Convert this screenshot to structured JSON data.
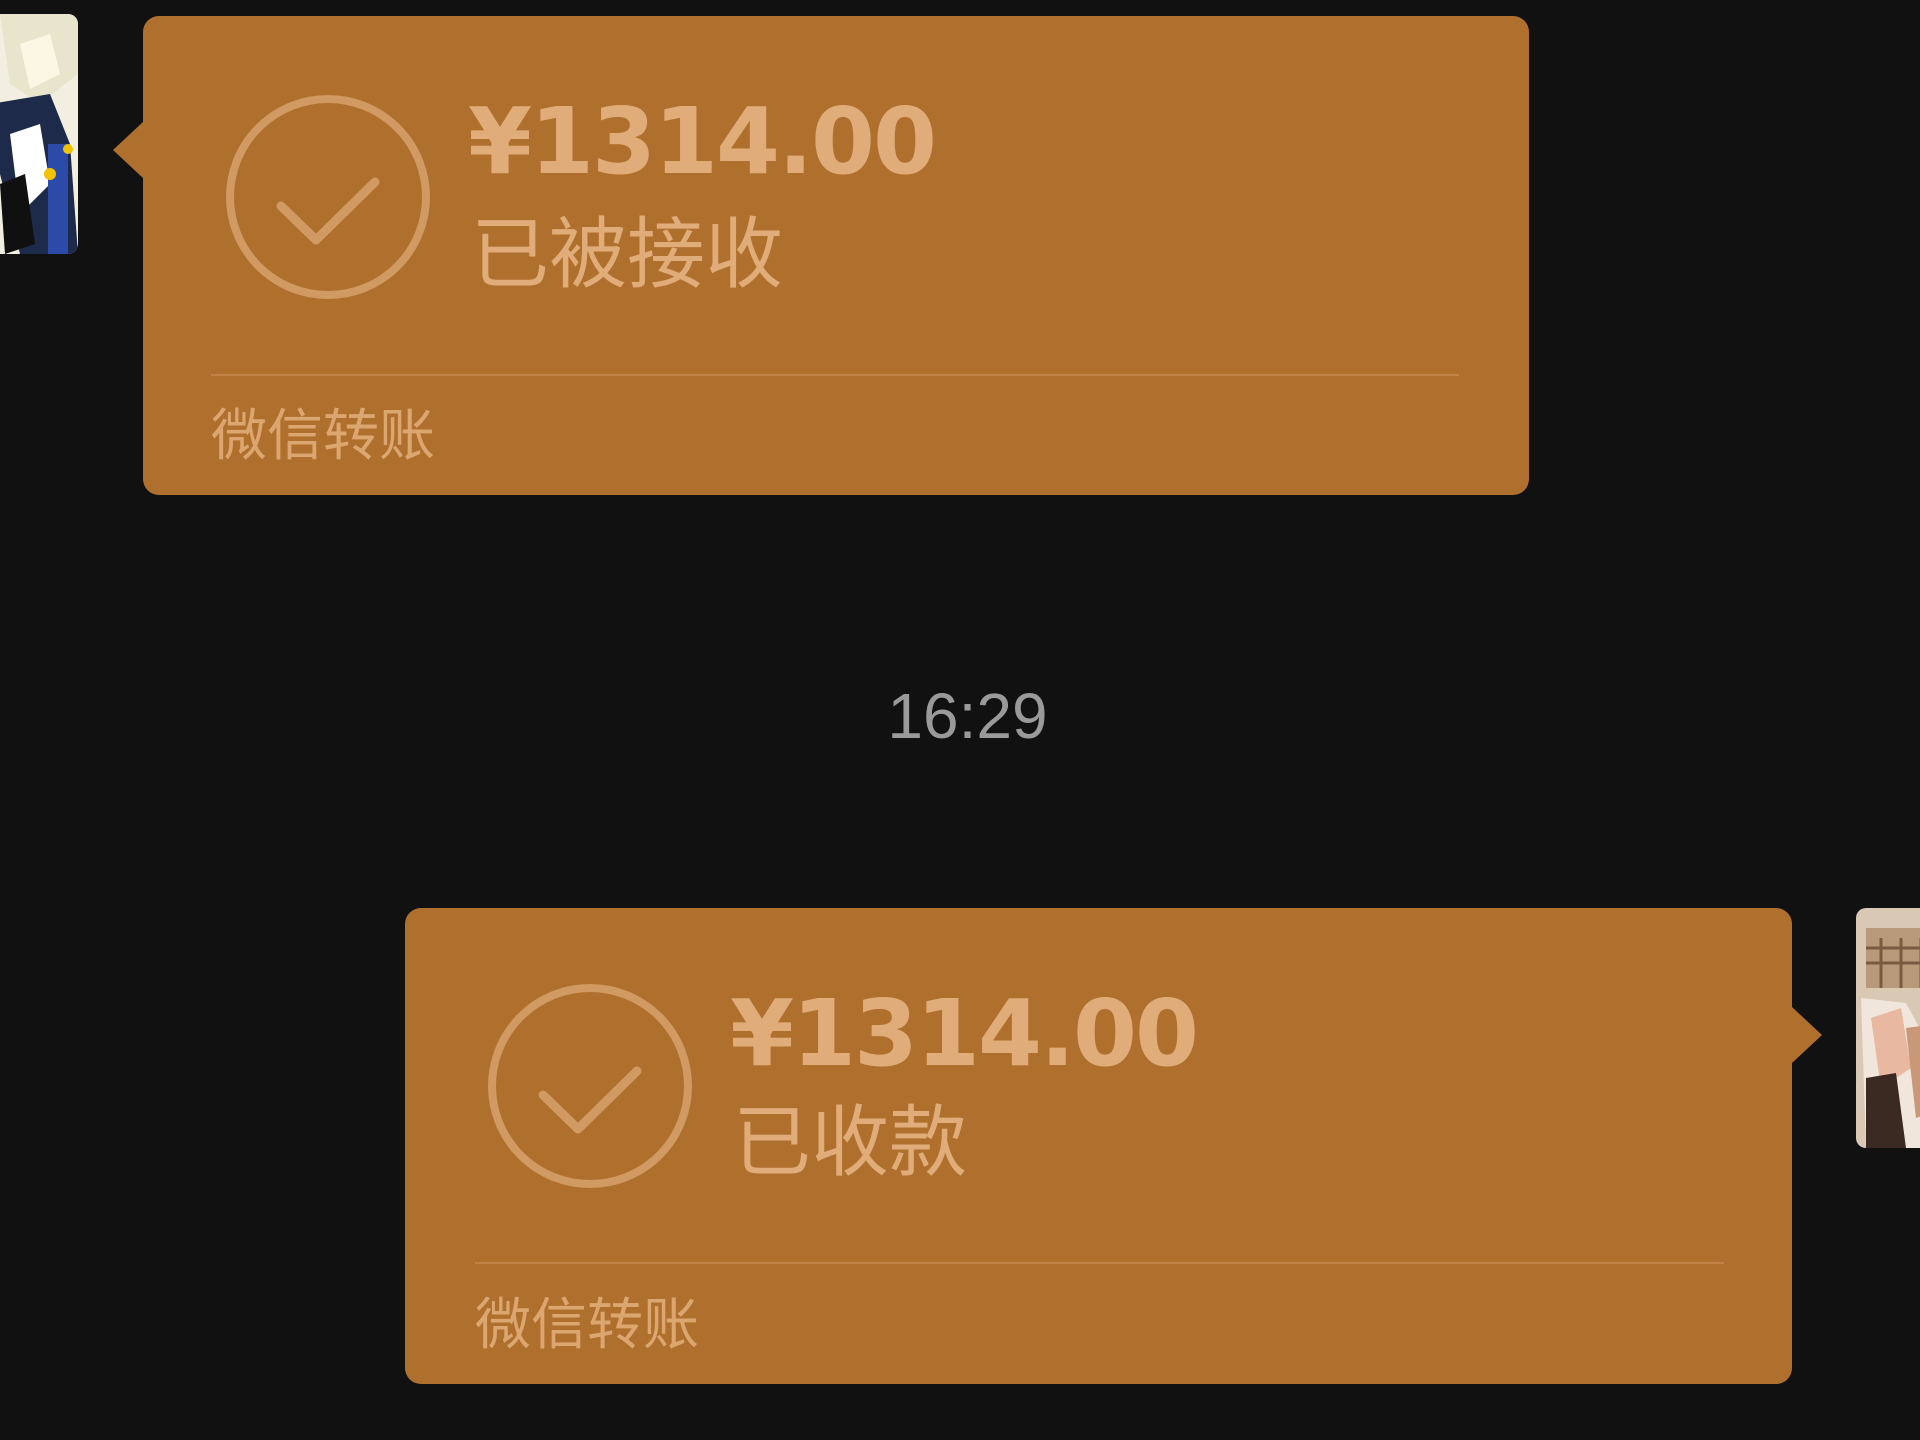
{
  "messages": [
    {
      "direction": "received",
      "amount": "¥1314.00",
      "status": "已被接收",
      "footer": "微信转账"
    },
    {
      "direction": "sent",
      "amount": "¥1314.00",
      "status": "已收款",
      "footer": "微信转账"
    }
  ],
  "timestamp": "16:29",
  "colors": {
    "background": "#111111",
    "bubble": "#b0702d",
    "bubble_text": "#e0ad7a",
    "timestamp_text": "#9a9a9a"
  },
  "icons": {
    "transfer_status": "check-circle-icon",
    "avatar_left": "anime-avatar-icon",
    "avatar_right": "anime-avatar-icon"
  }
}
